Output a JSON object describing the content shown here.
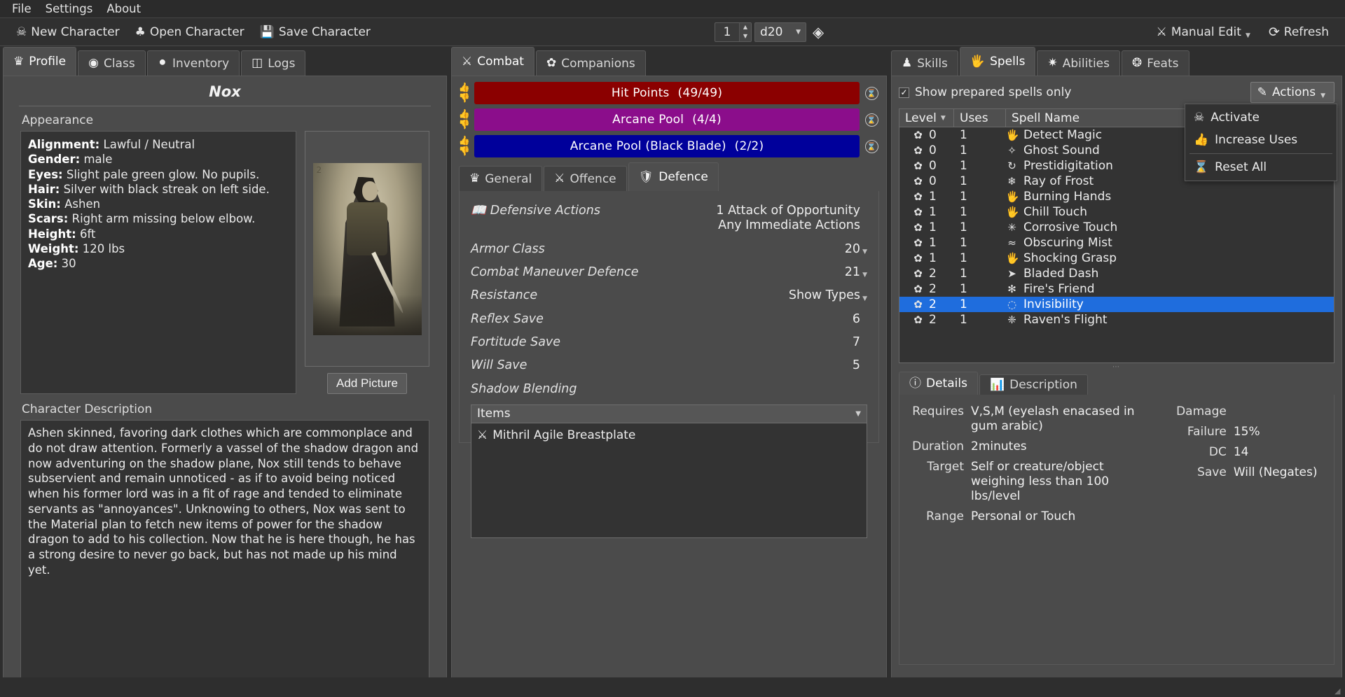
{
  "menubar": {
    "items": [
      "File",
      "Settings",
      "About"
    ]
  },
  "toolbar": {
    "new_character": "New Character",
    "open_character": "Open Character",
    "save_character": "Save Character",
    "dice_count": "1",
    "dice_type": "d20",
    "manual_edit": "Manual Edit",
    "refresh": "Refresh"
  },
  "left_tabs": [
    {
      "label": "Profile",
      "icon": "helmet-icon",
      "active": true
    },
    {
      "label": "Class",
      "icon": "hood-icon",
      "active": false
    },
    {
      "label": "Inventory",
      "icon": "bag-icon",
      "active": false
    },
    {
      "label": "Logs",
      "icon": "books-icon",
      "active": false
    }
  ],
  "profile": {
    "character_name": "Nox",
    "appearance_label": "Appearance",
    "appearance": [
      {
        "key": "Alignment:",
        "value": "Lawful / Neutral"
      },
      {
        "key": "Gender:",
        "value": "male"
      },
      {
        "key": "Eyes:",
        "value": "Slight pale green glow. No pupils."
      },
      {
        "key": "Hair:",
        "value": "Silver with black streak on left side."
      },
      {
        "key": "Skin:",
        "value": "Ashen"
      },
      {
        "key": "Scars:",
        "value": "Right arm missing below elbow."
      },
      {
        "key": "Height:",
        "value": "6ft"
      },
      {
        "key": "Weight:",
        "value": "120 lbs"
      },
      {
        "key": "Age:",
        "value": "30"
      }
    ],
    "portrait_number": "2",
    "add_picture": "Add Picture",
    "description_label": "Character Description",
    "description": "Ashen skinned, favoring dark clothes which are commonplace and do not draw attention. Formerly a vassel of the shadow dragon and now adventuring on the shadow plane, Nox still tends to behave subservient and remain unnoticed - as if to avoid being noticed when his former lord was in a fit of rage and tended to eliminate servants as  \"annoyances\". Unknowing to others, Nox was sent to the Material plan to fetch new items of power for the shadow dragon to add to his collection. Now that he is here though, he has a strong desire to never go back, but has not made up his mind yet."
  },
  "mid_tabs": [
    {
      "label": "Combat",
      "icon": "crossed-swords-icon",
      "active": true
    },
    {
      "label": "Companions",
      "icon": "paws-icon",
      "active": false
    }
  ],
  "stat_bars": [
    {
      "label": "Hit Points",
      "value": "(49/49)",
      "color": "#8B0000"
    },
    {
      "label": "Arcane Pool",
      "value": "(4/4)",
      "color": "#8B0D8B"
    },
    {
      "label": "Arcane Pool (Black Blade)",
      "value": "(2/2)",
      "color": "#00009B"
    }
  ],
  "combat_subtabs": [
    {
      "label": "General",
      "icon": "helmet-icon",
      "active": false
    },
    {
      "label": "Offence",
      "icon": "axe-icon",
      "active": false
    },
    {
      "label": "Defence",
      "icon": "shield-icon",
      "active": true
    }
  ],
  "defence": {
    "rows": [
      {
        "label": "Defensive Actions",
        "icon": "book-icon",
        "value": "1 Attack of Opportunity\nAny Immediate Actions",
        "caret": false
      },
      {
        "label": "Armor Class",
        "icon": "",
        "value": "20",
        "caret": true
      },
      {
        "label": "Combat Maneuver Defence",
        "icon": "",
        "value": "21",
        "caret": true
      },
      {
        "label": "Resistance",
        "icon": "",
        "value": "Show Types",
        "caret": true
      },
      {
        "label": "Reflex Save",
        "icon": "",
        "value": "6",
        "caret": false
      },
      {
        "label": "Fortitude Save",
        "icon": "",
        "value": "7",
        "caret": false
      },
      {
        "label": "Will Save",
        "icon": "",
        "value": "5",
        "caret": false
      },
      {
        "label": "Shadow Blending",
        "icon": "",
        "value": "",
        "caret": false
      }
    ],
    "items_header": "Items",
    "items": [
      {
        "name": "Mithril Agile Breastplate",
        "icon": "armor-icon"
      }
    ]
  },
  "right_tabs": [
    {
      "label": "Skills",
      "icon": "skills-icon",
      "active": false
    },
    {
      "label": "Spells",
      "icon": "spell-hand-icon",
      "active": true
    },
    {
      "label": "Abilities",
      "icon": "abilities-icon",
      "active": false
    },
    {
      "label": "Feats",
      "icon": "feats-icon",
      "active": false
    }
  ],
  "spells": {
    "show_prepared_label": "Show prepared spells only",
    "show_prepared_checked": true,
    "actions_label": "Actions",
    "actions_menu": [
      {
        "label": "Activate",
        "icon": "activate-icon"
      },
      {
        "label": "Increase Uses",
        "icon": "increase-uses-icon"
      },
      {
        "label": "Reset All",
        "icon": "reset-icon"
      }
    ],
    "columns": [
      "Level",
      "Uses",
      "Spell Name"
    ],
    "rows": [
      {
        "level": "0",
        "uses": "1",
        "name": "Detect Magic",
        "icon": "🖐",
        "selected": false
      },
      {
        "level": "0",
        "uses": "1",
        "name": "Ghost Sound",
        "icon": "✧",
        "selected": false
      },
      {
        "level": "0",
        "uses": "1",
        "name": "Prestidigitation",
        "icon": "↻",
        "selected": false
      },
      {
        "level": "0",
        "uses": "1",
        "name": "Ray of Frost",
        "icon": "❄",
        "selected": false
      },
      {
        "level": "1",
        "uses": "1",
        "name": "Burning Hands",
        "icon": "🖐",
        "selected": false
      },
      {
        "level": "1",
        "uses": "1",
        "name": "Chill Touch",
        "icon": "🖐",
        "selected": false
      },
      {
        "level": "1",
        "uses": "1",
        "name": "Corrosive Touch",
        "icon": "✳",
        "selected": false
      },
      {
        "level": "1",
        "uses": "1",
        "name": "Obscuring Mist",
        "icon": "≈",
        "selected": false
      },
      {
        "level": "1",
        "uses": "1",
        "name": "Shocking Grasp",
        "icon": "🖐",
        "selected": false
      },
      {
        "level": "2",
        "uses": "1",
        "name": "Bladed Dash",
        "icon": "➤",
        "selected": false
      },
      {
        "level": "2",
        "uses": "1",
        "name": "Fire's Friend",
        "icon": "✻",
        "selected": false
      },
      {
        "level": "2",
        "uses": "1",
        "name": "Invisibility",
        "icon": "◌",
        "selected": true
      },
      {
        "level": "2",
        "uses": "1",
        "name": "Raven's Flight",
        "icon": "❈",
        "selected": false
      }
    ]
  },
  "detail_tabs": [
    {
      "label": "Details",
      "icon": "info-icon",
      "active": true
    },
    {
      "label": "Description",
      "icon": "scroll-icon",
      "active": false
    }
  ],
  "spell_details": {
    "left": [
      {
        "key": "Requires",
        "value": "V,S,M (eyelash enacased in gum arabic)"
      },
      {
        "key": "Duration",
        "value": "2minutes"
      },
      {
        "key": "Target",
        "value": "Self or creature/object weighing less than 100 lbs/level"
      },
      {
        "key": "Range",
        "value": "Personal or Touch"
      }
    ],
    "right": [
      {
        "key": "Damage",
        "value": ""
      },
      {
        "key": "Failure",
        "value": "15%"
      },
      {
        "key": "DC",
        "value": "14"
      },
      {
        "key": "Save",
        "value": "Will (Negates)"
      }
    ]
  }
}
